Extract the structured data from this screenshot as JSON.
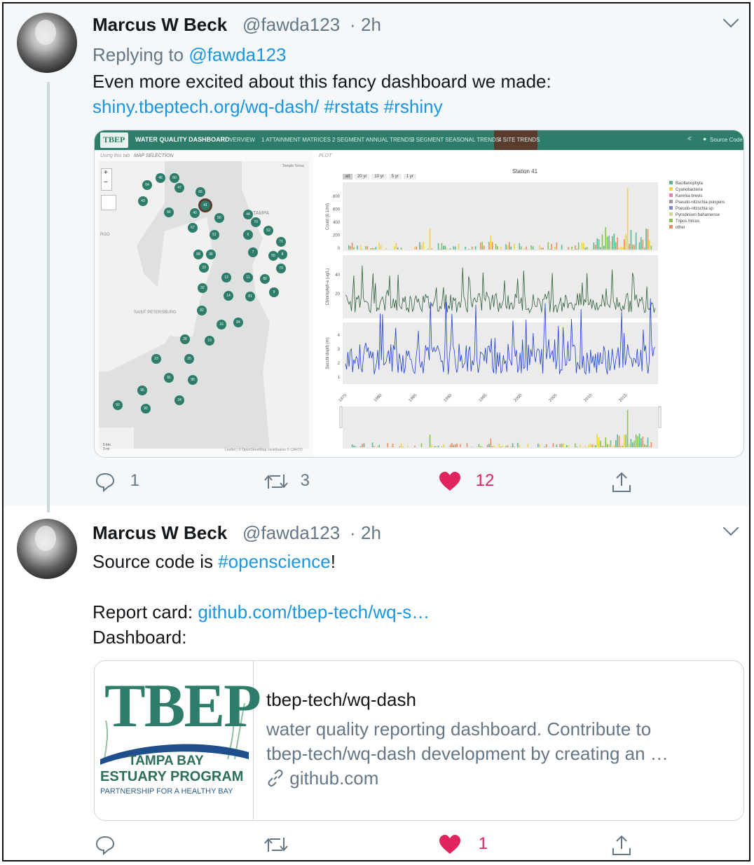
{
  "tweet1": {
    "author_name": "Marcus W Beck",
    "handle": "@fawda123",
    "dot": "·",
    "time": "2h",
    "replying_label": "Replying to",
    "replying_handle": "@fawda123",
    "text_line1": "Even more excited about this fancy dashboard we made:",
    "link_url": "shiny.tbeptech.org/wq-dash/",
    "hashtag1": "#rstats",
    "hashtag2": "#rshiny",
    "replies": "1",
    "retweets": "3",
    "likes": "12"
  },
  "dashboard": {
    "logo": "TBEP",
    "title": "WATER QUALITY DASHBOARD",
    "nav": [
      "OVERVIEW",
      "1 ATTAINMENT MATRICES",
      "2 SEGMENT ANNUAL TRENDS",
      "3 SEGMENT SEASONAL TRENDS",
      "4 SITE TRENDS"
    ],
    "source_code": "Source Code",
    "subtabs": [
      "Using this tab",
      "MAP SELECTION"
    ],
    "plot_tab": "PLOT",
    "map_labels": {
      "tampa": "TAMPA",
      "stpete": "SAINT PETERSBURG",
      "temple": "Temple Terrac",
      "rgo": "RGO"
    },
    "zoom_in": "+",
    "zoom_out": "−",
    "range_buttons": [
      "all",
      "20 yr",
      "10 yr",
      "5 yr",
      "1 yr"
    ],
    "plot_title": "Station 41",
    "y_labels": [
      "Count (0.1/ml)",
      "Chlorophyll-a (ug/L)",
      "Secchi depth (m)"
    ],
    "count_ticks": [
      "800",
      "600",
      "400",
      "200",
      "0"
    ],
    "chl_ticks": [
      "40",
      "20"
    ],
    "secchi_ticks": [
      "4",
      "3",
      "2",
      "1"
    ],
    "year_ticks": [
      "1975",
      "1980",
      "1985",
      "1990",
      "1995",
      "2000",
      "2005",
      "2010",
      "2015"
    ],
    "legend": [
      {
        "name": "Bacillariophyta",
        "color": "#57b98f"
      },
      {
        "name": "Cyanobacteria",
        "color": "#f2d33a"
      },
      {
        "name": "Karenia brevis",
        "color": "#e57db3"
      },
      {
        "name": "Pseudo-nitzschia pungens",
        "color": "#999999"
      },
      {
        "name": "Pseudo-nitzschia sp.",
        "color": "#7f7fd5"
      },
      {
        "name": "Pyrodinium bahamense",
        "color": "#d6d694"
      },
      {
        "name": "Tripos hircus",
        "color": "#8bc34a"
      },
      {
        "name": "other",
        "color": "#f08a5d"
      }
    ],
    "map_attribution": "Leaflet | © OpenStreetMap contributors © CARTO",
    "scale": [
      "5 km",
      "3 mi"
    ],
    "stations": [
      "64",
      "46",
      "60",
      "47",
      "65",
      "43",
      "66",
      "41",
      "40",
      "50",
      "44",
      "70",
      "52",
      "67",
      "51",
      "6",
      "71",
      "68",
      "36",
      "7",
      "55",
      "8",
      "33",
      "73",
      "13",
      "11",
      "80",
      "32",
      "14",
      "81",
      "9",
      "82",
      "16",
      "84",
      "28",
      "19",
      "23",
      "25",
      "91",
      "90",
      "95",
      "24",
      "93",
      "92"
    ]
  },
  "tweet2": {
    "author_name": "Marcus W Beck",
    "handle": "@fawda123",
    "dot": "·",
    "time": "2h",
    "text_prefix": "Source code is",
    "hashtag": "#opensciencе",
    "text_suffix": "!",
    "report_label": "Report card:",
    "report_link": "github.com/tbep-tech/wq-s…",
    "dashboard_label": "Dashboard:",
    "likes": "1"
  },
  "card": {
    "logo_big": "TBEP",
    "logo_line1": "TAMPA BAY",
    "logo_line2": "ESTUARY PROGRAM",
    "logo_line3": "PARTNERSHIP FOR A HEALTHY BAY",
    "title": "tbep-tech/wq-dash",
    "desc_line1": "water quality reporting dashboard. Contribute to",
    "desc_line2": "tbep-tech/wq-dash development by creating an …",
    "domain": "github.com"
  },
  "colors": {
    "link": "#1b95e0",
    "like": "#e0245e",
    "dash_green": "#2d7d6a",
    "station": "#2e7d6b"
  }
}
